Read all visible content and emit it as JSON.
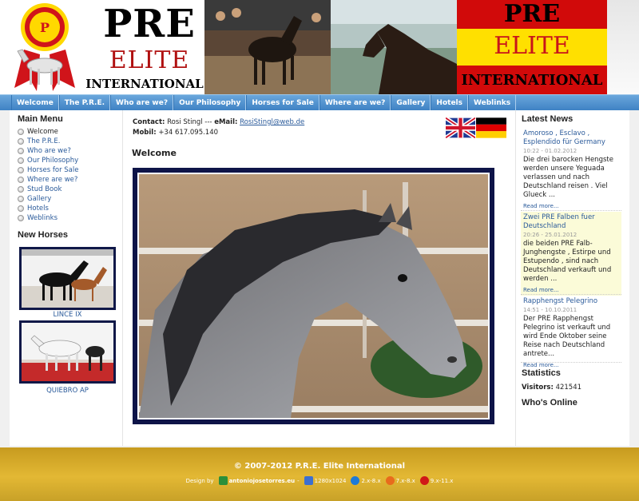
{
  "header": {
    "title_pre": "PRE",
    "title_elite": "ELITE",
    "title_international": "INTERNATIONAL",
    "flag_pre": "PRE",
    "flag_elite": "ELITE",
    "flag_international": "INTERNATIONAL"
  },
  "nav": {
    "items": [
      "Welcome",
      "The P.R.E.",
      "Who are we?",
      "Our Philosophy",
      "Horses for Sale",
      "Where are we?",
      "Gallery",
      "Hotels",
      "Weblinks"
    ]
  },
  "left": {
    "menu_title": "Main Menu",
    "menu_items": [
      "Welcome",
      "The P.R.E.",
      "Who are we?",
      "Our Philosophy",
      "Horses for Sale",
      "Where are we?",
      "Stud Book",
      "Gallery",
      "Hotels",
      "Weblinks"
    ],
    "new_horses_title": "New Horses",
    "horses": [
      "LINCE IX",
      "QUIEBRO AP"
    ]
  },
  "main": {
    "contact_label": "Contact:",
    "contact_name": "Rosi Stingl --- ",
    "email_label": "eMail:",
    "email": "RosiStingl@web.de",
    "mobil_label": "Mobil:",
    "mobil": "+34 617.095.140",
    "page_title": "Welcome"
  },
  "right": {
    "news_title": "Latest News",
    "news": [
      {
        "headline": "Amoroso , Esclavo , Esplendido für Germany",
        "date": "10:22 - 01.02.2012",
        "body": "Die drei barocken Hengste werden unsere Yeguada verlassen und nach Deutschland reisen . Viel Glueck ...",
        "more": "Read more..."
      },
      {
        "headline": "Zwei PRE Falben fuer Deutschland",
        "date": "20:26 - 25.01.2012",
        "body": "die beiden PRE Falb-Junghengste , Estirpe und Estupendo , sind nach Deutschland verkauft und werden ...",
        "more": "Read more..."
      },
      {
        "headline": "Rapphengst Pelegrino",
        "date": "14:51 - 10.10.2011",
        "body": "Der PRE Rapphengst Pelegrino ist verkauft und wird Ende Oktober seine Reise nach Deutschland antrete...",
        "more": "Read more..."
      }
    ],
    "stats_title": "Statistics",
    "visitors_label": "Visitors:",
    "visitors_value": "421541",
    "online_title": "Who's Online"
  },
  "footer": {
    "copyright": "© 2007-2012 P.R.E. Elite International",
    "design_by": "Design by",
    "designer": "antoniojosetorres.eu",
    "sep": "-",
    "res": "1280x1024",
    "ie": "2.x-8.x",
    "ff": "7.x-8.x",
    "op": "9.x-11.x"
  },
  "colors": {
    "nav": "#4a8fd0",
    "link": "#2a5a9a",
    "footer": "#d9ad2c",
    "photo_frame": "#0e1448"
  }
}
